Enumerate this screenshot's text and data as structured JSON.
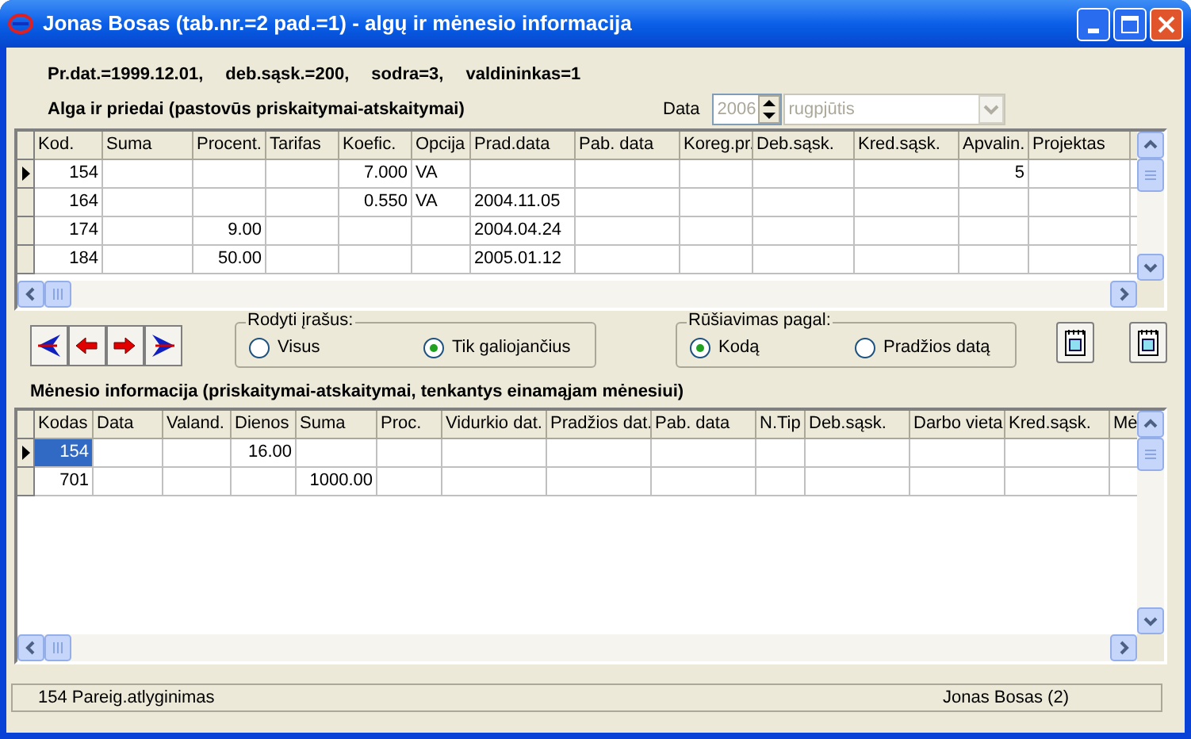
{
  "window": {
    "title": "Jonas Bosas (tab.nr.=2 pad.=1) - algų ir mėnesio informacija"
  },
  "info_line": [
    "Pr.dat.=1999.12.01,",
    "deb.sąsk.=200,",
    "sodra=3,",
    "valdininkas=1"
  ],
  "salary_section": {
    "title": "Alga ir priedai (pastovūs priskaitymai-atskaitymai)",
    "date_label": "Data",
    "year": "2006",
    "month": "rugpjūtis",
    "date_disabled": true
  },
  "salary_table": {
    "columns": [
      "Kod.",
      "Suma",
      "Procent.",
      "Tarifas",
      "Koefic.",
      "Opcija",
      "Prad.data",
      "Pab. data",
      "Koreg.pr.",
      "Deb.sąsk.",
      "Kred.sąsk.",
      "Apvalin.",
      "Projektas"
    ],
    "rows": [
      {
        "current": true,
        "cells": [
          "154",
          null,
          null,
          null,
          "7.000",
          "VA",
          null,
          null,
          null,
          null,
          null,
          "5",
          null
        ]
      },
      {
        "current": false,
        "cells": [
          "164",
          null,
          null,
          null,
          "0.550",
          "VA",
          "2004.11.05",
          null,
          null,
          null,
          null,
          null,
          null
        ]
      },
      {
        "current": false,
        "cells": [
          "174",
          null,
          "9.00",
          null,
          null,
          null,
          "2004.04.24",
          null,
          null,
          null,
          null,
          null,
          null
        ]
      },
      {
        "current": false,
        "cells": [
          "184",
          null,
          "50.00",
          null,
          null,
          null,
          "2005.01.12",
          null,
          null,
          null,
          null,
          null,
          null
        ]
      }
    ]
  },
  "nav_buttons": [
    {
      "kind": "first"
    },
    {
      "kind": "prev"
    },
    {
      "kind": "next"
    },
    {
      "kind": "last"
    }
  ],
  "show_records": {
    "title": "Rodyti įrašus:",
    "options": [
      {
        "label": "Visus",
        "selected": false
      },
      {
        "label": "Tik galiojančius",
        "selected": true
      }
    ]
  },
  "sort_by": {
    "title": "Rūšiavimas pagal:",
    "options": [
      {
        "label": "Kodą",
        "selected": true
      },
      {
        "label": "Pradžios datą",
        "selected": false
      }
    ]
  },
  "month_section": {
    "title": "Mėnesio informacija (priskaitymai-atskaitymai, tenkantys einamąjam mėnesiui)"
  },
  "month_table": {
    "columns": [
      "Kodas",
      "Data",
      "Valand.",
      "Dienos",
      "Suma",
      "Proc.",
      "Vidurkio dat.",
      "Pradžios dat.",
      "Pab. data",
      "N.Tip",
      "Deb.sąsk.",
      "Darbo vieta",
      "Kred.sąsk.",
      "Mė"
    ],
    "rows": [
      {
        "current": true,
        "selected": true,
        "cells": [
          "154",
          null,
          null,
          "16.00",
          null,
          null,
          null,
          null,
          null,
          null,
          null,
          null,
          null,
          null
        ]
      },
      {
        "current": false,
        "selected": false,
        "cells": [
          "701",
          null,
          null,
          null,
          "1000.00",
          null,
          null,
          null,
          null,
          null,
          null,
          null,
          null,
          null
        ]
      }
    ]
  },
  "status_bar": {
    "left": "154 Pareig.atlyginimas",
    "right": "Jonas Bosas (2)"
  }
}
